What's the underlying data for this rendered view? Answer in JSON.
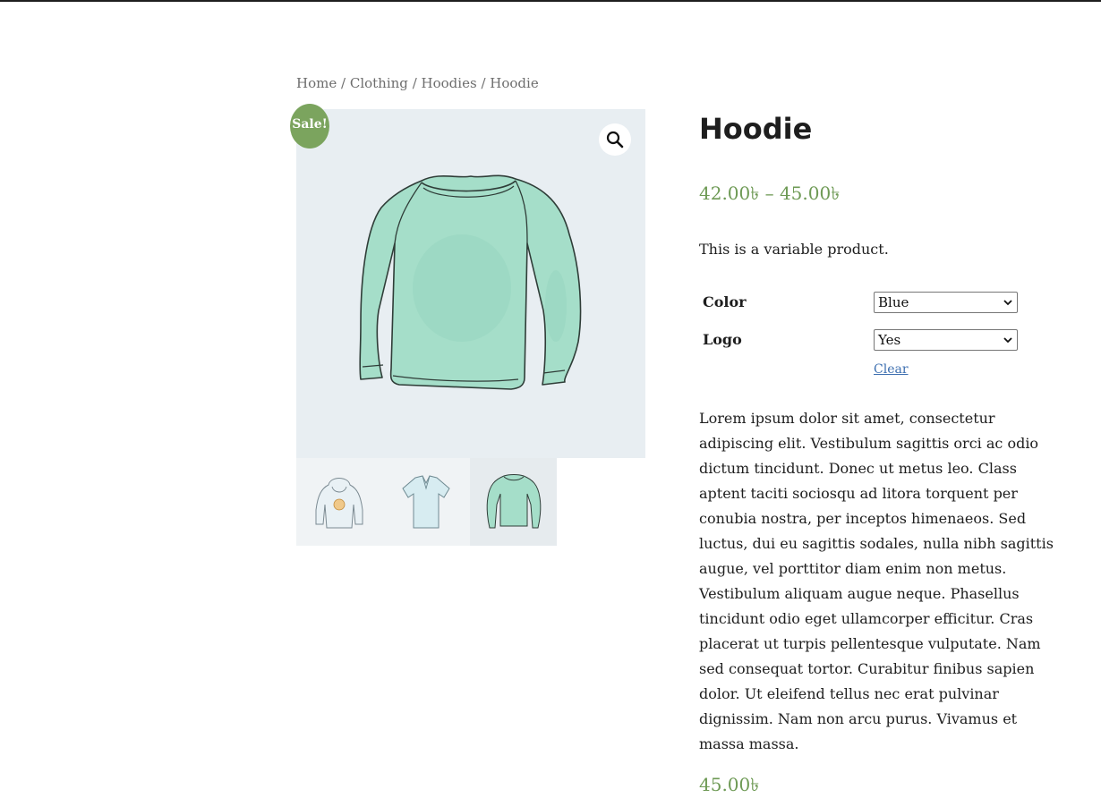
{
  "breadcrumb": {
    "items": [
      "Home",
      "Clothing",
      "Hoodies",
      "Hoodie"
    ],
    "separator": "/"
  },
  "product": {
    "sale_badge": "Sale!",
    "title": "Hoodie",
    "price_min": "42.00৳",
    "price_dash": "–",
    "price_max": "45.00৳",
    "short_description": "This is a variable product.",
    "variations": {
      "color_label": "Color",
      "color_value": "Blue",
      "logo_label": "Logo",
      "logo_value": "Yes",
      "clear_label": "Clear"
    },
    "long_description": "Lorem ipsum dolor sit amet, consectetur adipiscing elit. Vestibulum sagittis orci ac odio dictum tincidunt. Donec ut metus leo. Class aptent taciti sociosqu ad litora torquent per conubia nostra, per inceptos himenaeos. Sed luctus, dui eu sagittis sodales, nulla nibh sagittis augue, vel porttitor diam enim non metus. Vestibulum aliquam augue neque. Phasellus tincidunt odio eget ullamcorper efficitur. Cras placerat ut turpis pellentesque vulputate. Nam sed consequat tortor. Curabitur finibus sapien dolor. Ut eleifend tellus nec erat pulvinar dignissim. Nam non arcu purus. Vivamus et massa massa.",
    "variation_price": "45.00৳"
  },
  "gallery": {
    "main_image": "long-sleeve-shirt-image",
    "zoom_icon": "magnifier-icon",
    "thumbnails": [
      "hoodie-thumbnail",
      "polo-thumbnail",
      "long-sleeve-thumbnail"
    ],
    "active_thumbnail": 2
  },
  "colors": {
    "accent_green": "#7ba45e",
    "price_green": "#6e9a55",
    "link_blue": "#3d6fb0",
    "image_bg": "#e8eef2",
    "shirt_mint": "#9fdcc6"
  }
}
